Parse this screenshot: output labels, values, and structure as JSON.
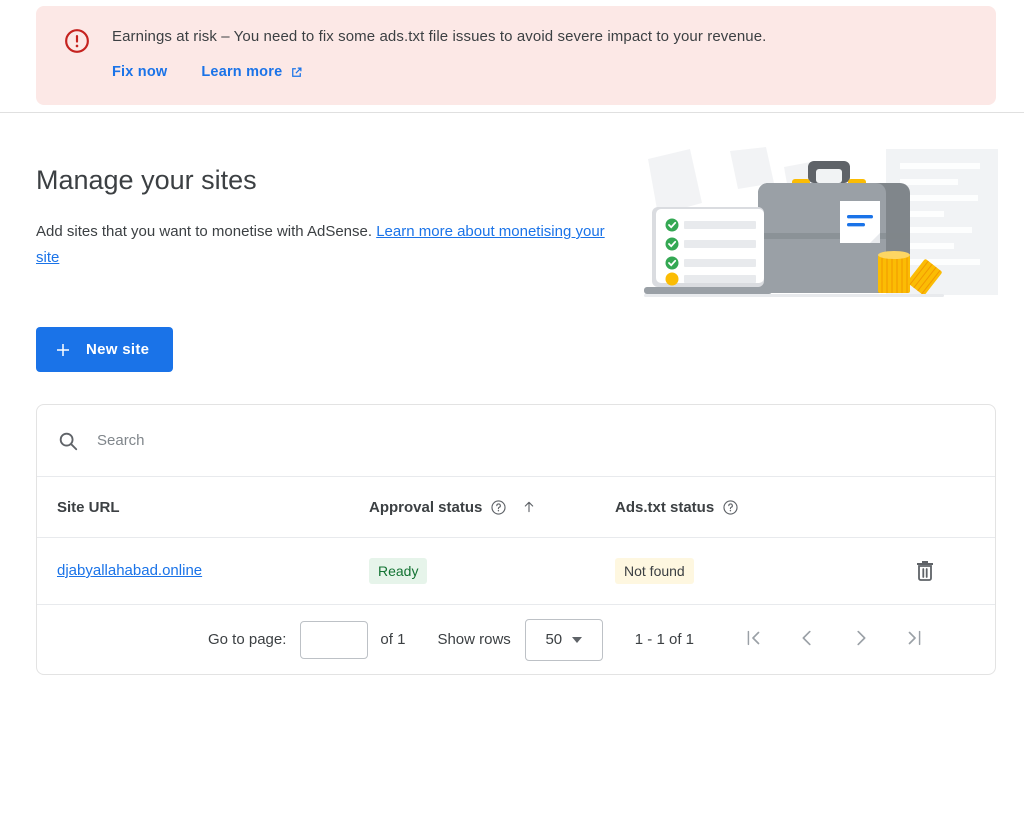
{
  "banner": {
    "icon": "error-circle-icon",
    "message": "Earnings at risk – You need to fix some ads.txt file issues to avoid severe impact to your revenue.",
    "fix_label": "Fix now",
    "learn_label": "Learn more",
    "external_icon": "external-link-icon",
    "bg_color": "#FCE8E6",
    "icon_color": "#C5221F",
    "link_color": "#1A73E8"
  },
  "hero": {
    "title": "Manage your sites",
    "subtitle_text": "Add sites that you want to monetise with AdSense. ",
    "subtitle_link": "Learn more about monetising your site",
    "illustration": "briefcase-checklist-coins-illustration"
  },
  "actions": {
    "new_site_label": "New site",
    "new_site_icon": "plus-icon",
    "accent_color": "#1A73E8"
  },
  "table": {
    "search": {
      "icon": "search-icon",
      "placeholder": "Search",
      "value": ""
    },
    "columns": [
      {
        "label": "Site URL",
        "help": false,
        "sorted": false
      },
      {
        "label": "Approval status",
        "help": true,
        "help_icon": "help-circle-icon",
        "sorted": true,
        "sort_icon": "arrow-up-icon"
      },
      {
        "label": "Ads.txt status",
        "help": true,
        "help_icon": "help-circle-icon",
        "sorted": false
      },
      {
        "label": "",
        "help": false,
        "sorted": false
      }
    ],
    "rows": [
      {
        "site_url": "djabyallahabad.online",
        "approval_status": "Ready",
        "approval_color": "#137333",
        "approval_bg": "#E6F4EA",
        "ads_txt_status": "Not found",
        "ads_txt_color": "#3C4043",
        "ads_txt_bg": "#FEF7E0",
        "delete_icon": "trash-icon"
      }
    ]
  },
  "pagination": {
    "go_to_page_label": "Go to page:",
    "page_value": "",
    "of_label": "of 1",
    "show_rows_label": "Show rows",
    "rows_per_page": "50",
    "rows_caret_icon": "chevron-down-icon",
    "range_label": "1 - 1 of 1",
    "first_icon": "first-page-icon",
    "prev_icon": "previous-page-icon",
    "next_icon": "next-page-icon",
    "last_icon": "last-page-icon"
  }
}
